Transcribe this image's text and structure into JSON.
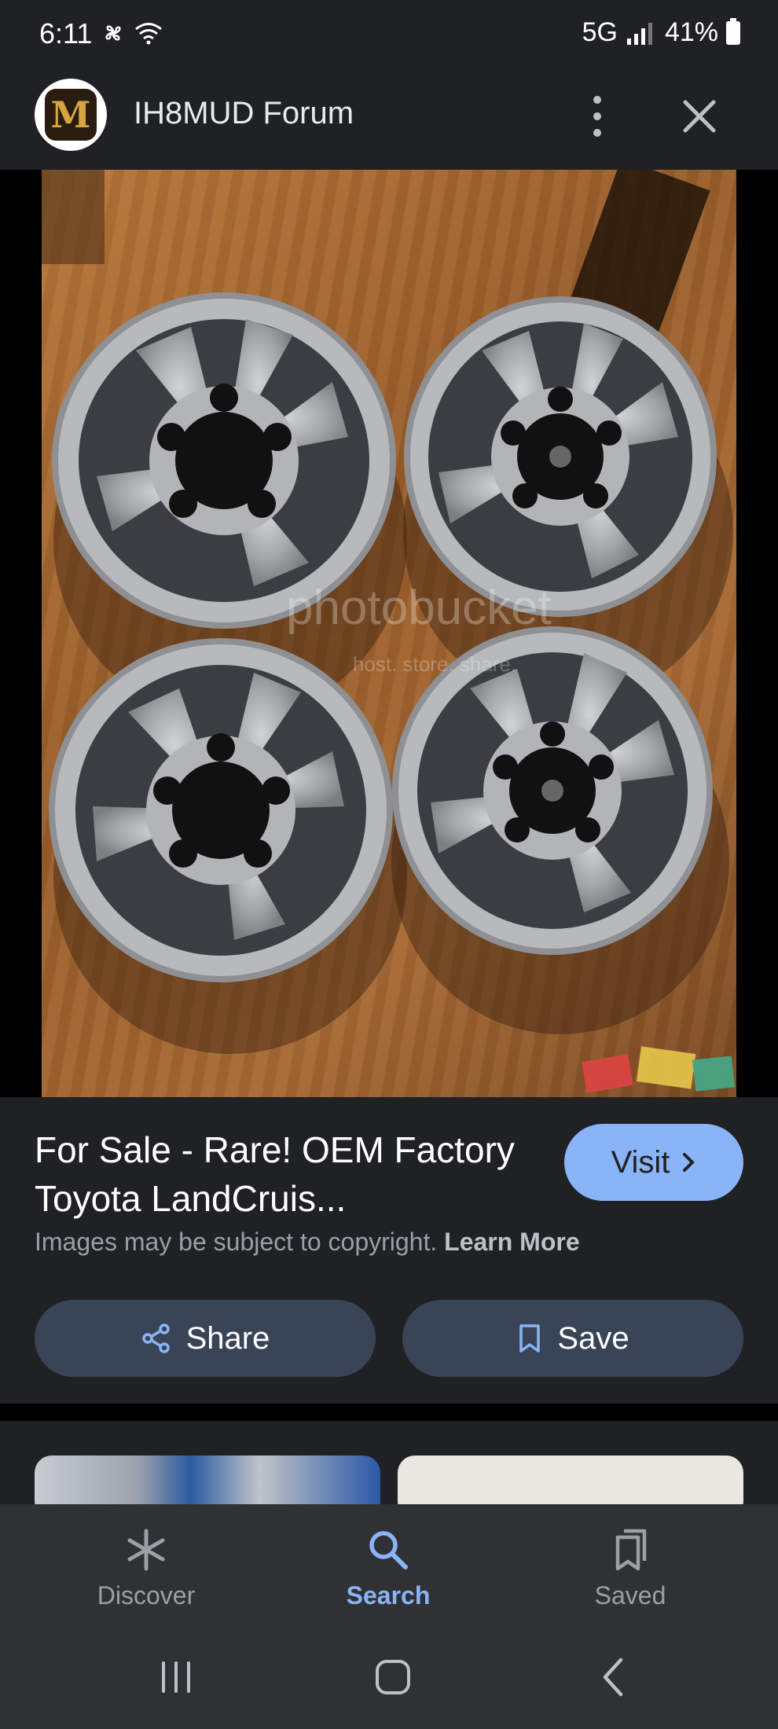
{
  "status_bar": {
    "time": "6:11",
    "network": "5G",
    "battery": "41%"
  },
  "header": {
    "site_name": "IH8MUD Forum",
    "logo_letter": "M"
  },
  "image": {
    "watermark": "photobucket",
    "watermark_sub": "host. store. share."
  },
  "result": {
    "title": "For Sale - Rare! OEM Factory Toyota LandCruis...",
    "visit_label": "Visit",
    "copyright_text": "Images may be subject to copyright.",
    "learn_more": "Learn More",
    "share_label": "Share",
    "save_label": "Save"
  },
  "bottom_nav": {
    "items": [
      {
        "label": "Discover",
        "icon": "asterisk-icon"
      },
      {
        "label": "Search",
        "icon": "search-icon",
        "active": true
      },
      {
        "label": "Saved",
        "icon": "bookmarks-icon"
      }
    ]
  },
  "colors": {
    "accent": "#8ab4f8",
    "panel": "#202124",
    "button": "#394457",
    "nav": "#303134"
  }
}
